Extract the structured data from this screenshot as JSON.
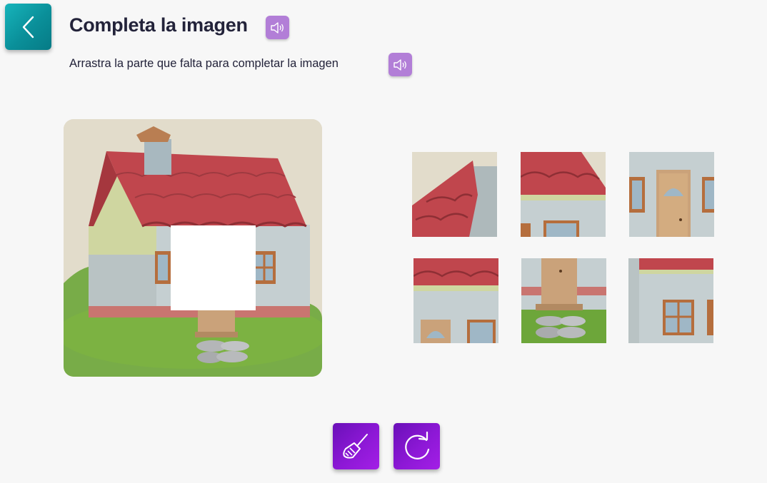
{
  "header": {
    "title": "Completa la imagen",
    "instruction": "Arrastra la parte que falta para completar la imagen"
  },
  "icons": {
    "back": "chevron-left-icon",
    "audio": "speaker-icon",
    "clear": "broom-icon",
    "restart": "restart-icon"
  },
  "colors": {
    "back_button": "#0a9aa3",
    "audio_button": "#b27ed7",
    "action_button": "#8a1ad4",
    "background": "#f7f7f7"
  },
  "puzzle": {
    "image": "house-illustration",
    "missing_piece": "front-wall-section",
    "options": [
      {
        "id": 1,
        "depicts": "roof-edge-and-chimney-corner"
      },
      {
        "id": 2,
        "depicts": "roof-and-window-top"
      },
      {
        "id": 3,
        "depicts": "door-with-windows"
      },
      {
        "id": 4,
        "depicts": "roof-and-window-tops"
      },
      {
        "id": 5,
        "depicts": "door-bottom-and-stones"
      },
      {
        "id": 6,
        "depicts": "wall-with-window"
      }
    ]
  }
}
